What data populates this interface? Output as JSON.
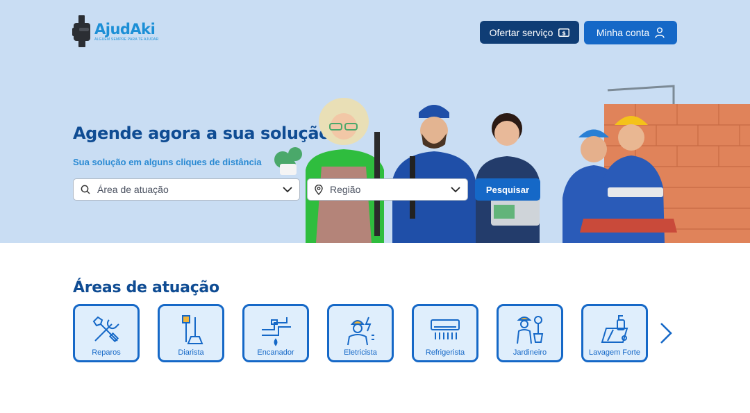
{
  "brand": {
    "name": "AjudAki",
    "tagline": "ALGUÉM SEMPRE PARA TE AJUDAR"
  },
  "header": {
    "offer_label": "Ofertar serviço",
    "account_label": "Minha conta"
  },
  "hero": {
    "title": "Agende agora a sua solução",
    "subtitle": "Sua solução em alguns cliques de distância"
  },
  "search": {
    "area_placeholder": "Área de atuação",
    "region_placeholder": "Região",
    "button_label": "Pesquisar"
  },
  "areas": {
    "title": "Áreas de atuação",
    "items": [
      {
        "label": "Reparos",
        "icon": "tools-icon"
      },
      {
        "label": "Diarista",
        "icon": "broom-icon"
      },
      {
        "label": "Encanador",
        "icon": "pipe-icon"
      },
      {
        "label": "Eletricista",
        "icon": "electrician-icon"
      },
      {
        "label": "Refrigerista",
        "icon": "air-conditioner-icon"
      },
      {
        "label": "Jardineiro",
        "icon": "gardener-icon"
      },
      {
        "label": "Lavagem Forte",
        "icon": "pressure-washer-icon"
      }
    ]
  },
  "colors": {
    "primary": "#1568c7",
    "dark": "#0f3d75",
    "hero_bg": "#c9ddf3",
    "card_bg": "#dfeefc"
  }
}
